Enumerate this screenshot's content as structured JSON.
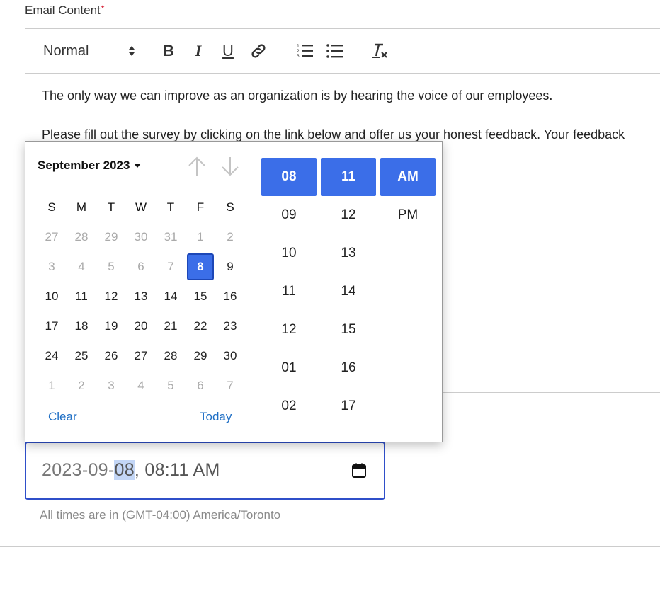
{
  "field_label": "Email Content",
  "required_mark": "*",
  "toolbar": {
    "format": "Normal",
    "bold": "B",
    "italic": "I",
    "underline": "U",
    "clear": "T"
  },
  "content": {
    "paragraphs": [
      "The only way we can improve as an organization is by hearing the voice of our employees.",
      "Please fill out the survey by clicking on the link below and offer us your honest feedback. Your feedback"
    ]
  },
  "datepicker": {
    "month_label": "September 2023",
    "weekdays": [
      "S",
      "M",
      "T",
      "W",
      "T",
      "F",
      "S"
    ],
    "weeks": [
      [
        {
          "d": "27",
          "m": true
        },
        {
          "d": "28",
          "m": true
        },
        {
          "d": "29",
          "m": true
        },
        {
          "d": "30",
          "m": true
        },
        {
          "d": "31",
          "m": true
        },
        {
          "d": "1",
          "m": true
        },
        {
          "d": "2",
          "m": true
        }
      ],
      [
        {
          "d": "3",
          "m": true
        },
        {
          "d": "4",
          "m": true
        },
        {
          "d": "5",
          "m": true
        },
        {
          "d": "6",
          "m": true
        },
        {
          "d": "7",
          "m": true
        },
        {
          "d": "8",
          "s": true
        },
        {
          "d": "9"
        }
      ],
      [
        {
          "d": "10"
        },
        {
          "d": "11"
        },
        {
          "d": "12"
        },
        {
          "d": "13"
        },
        {
          "d": "14"
        },
        {
          "d": "15"
        },
        {
          "d": "16"
        }
      ],
      [
        {
          "d": "17"
        },
        {
          "d": "18"
        },
        {
          "d": "19"
        },
        {
          "d": "20"
        },
        {
          "d": "21"
        },
        {
          "d": "22"
        },
        {
          "d": "23"
        }
      ],
      [
        {
          "d": "24"
        },
        {
          "d": "25"
        },
        {
          "d": "26"
        },
        {
          "d": "27"
        },
        {
          "d": "28"
        },
        {
          "d": "29"
        },
        {
          "d": "30"
        }
      ],
      [
        {
          "d": "1",
          "m": true
        },
        {
          "d": "2",
          "m": true
        },
        {
          "d": "3",
          "m": true
        },
        {
          "d": "4",
          "m": true
        },
        {
          "d": "5",
          "m": true
        },
        {
          "d": "6",
          "m": true
        },
        {
          "d": "7",
          "m": true
        }
      ]
    ],
    "clear_label": "Clear",
    "today_label": "Today",
    "hours": [
      "08",
      "09",
      "10",
      "11",
      "12",
      "01",
      "02"
    ],
    "minutes": [
      "11",
      "12",
      "13",
      "14",
      "15",
      "16",
      "17"
    ],
    "ampm": [
      "AM",
      "PM"
    ],
    "selected_hour": "08",
    "selected_minute": "11",
    "selected_ampm": "AM"
  },
  "input": {
    "value_prefix": "2023-09-",
    "value_highlight": "08",
    "value_suffix": ", 08:11 AM"
  },
  "timezone_note": "All times are in (GMT-04:00) America/Toronto",
  "colors": {
    "accent": "#3b6ee8",
    "link": "#1f6fc5",
    "required": "#d0021b",
    "focus_border": "#2f4fc9"
  }
}
